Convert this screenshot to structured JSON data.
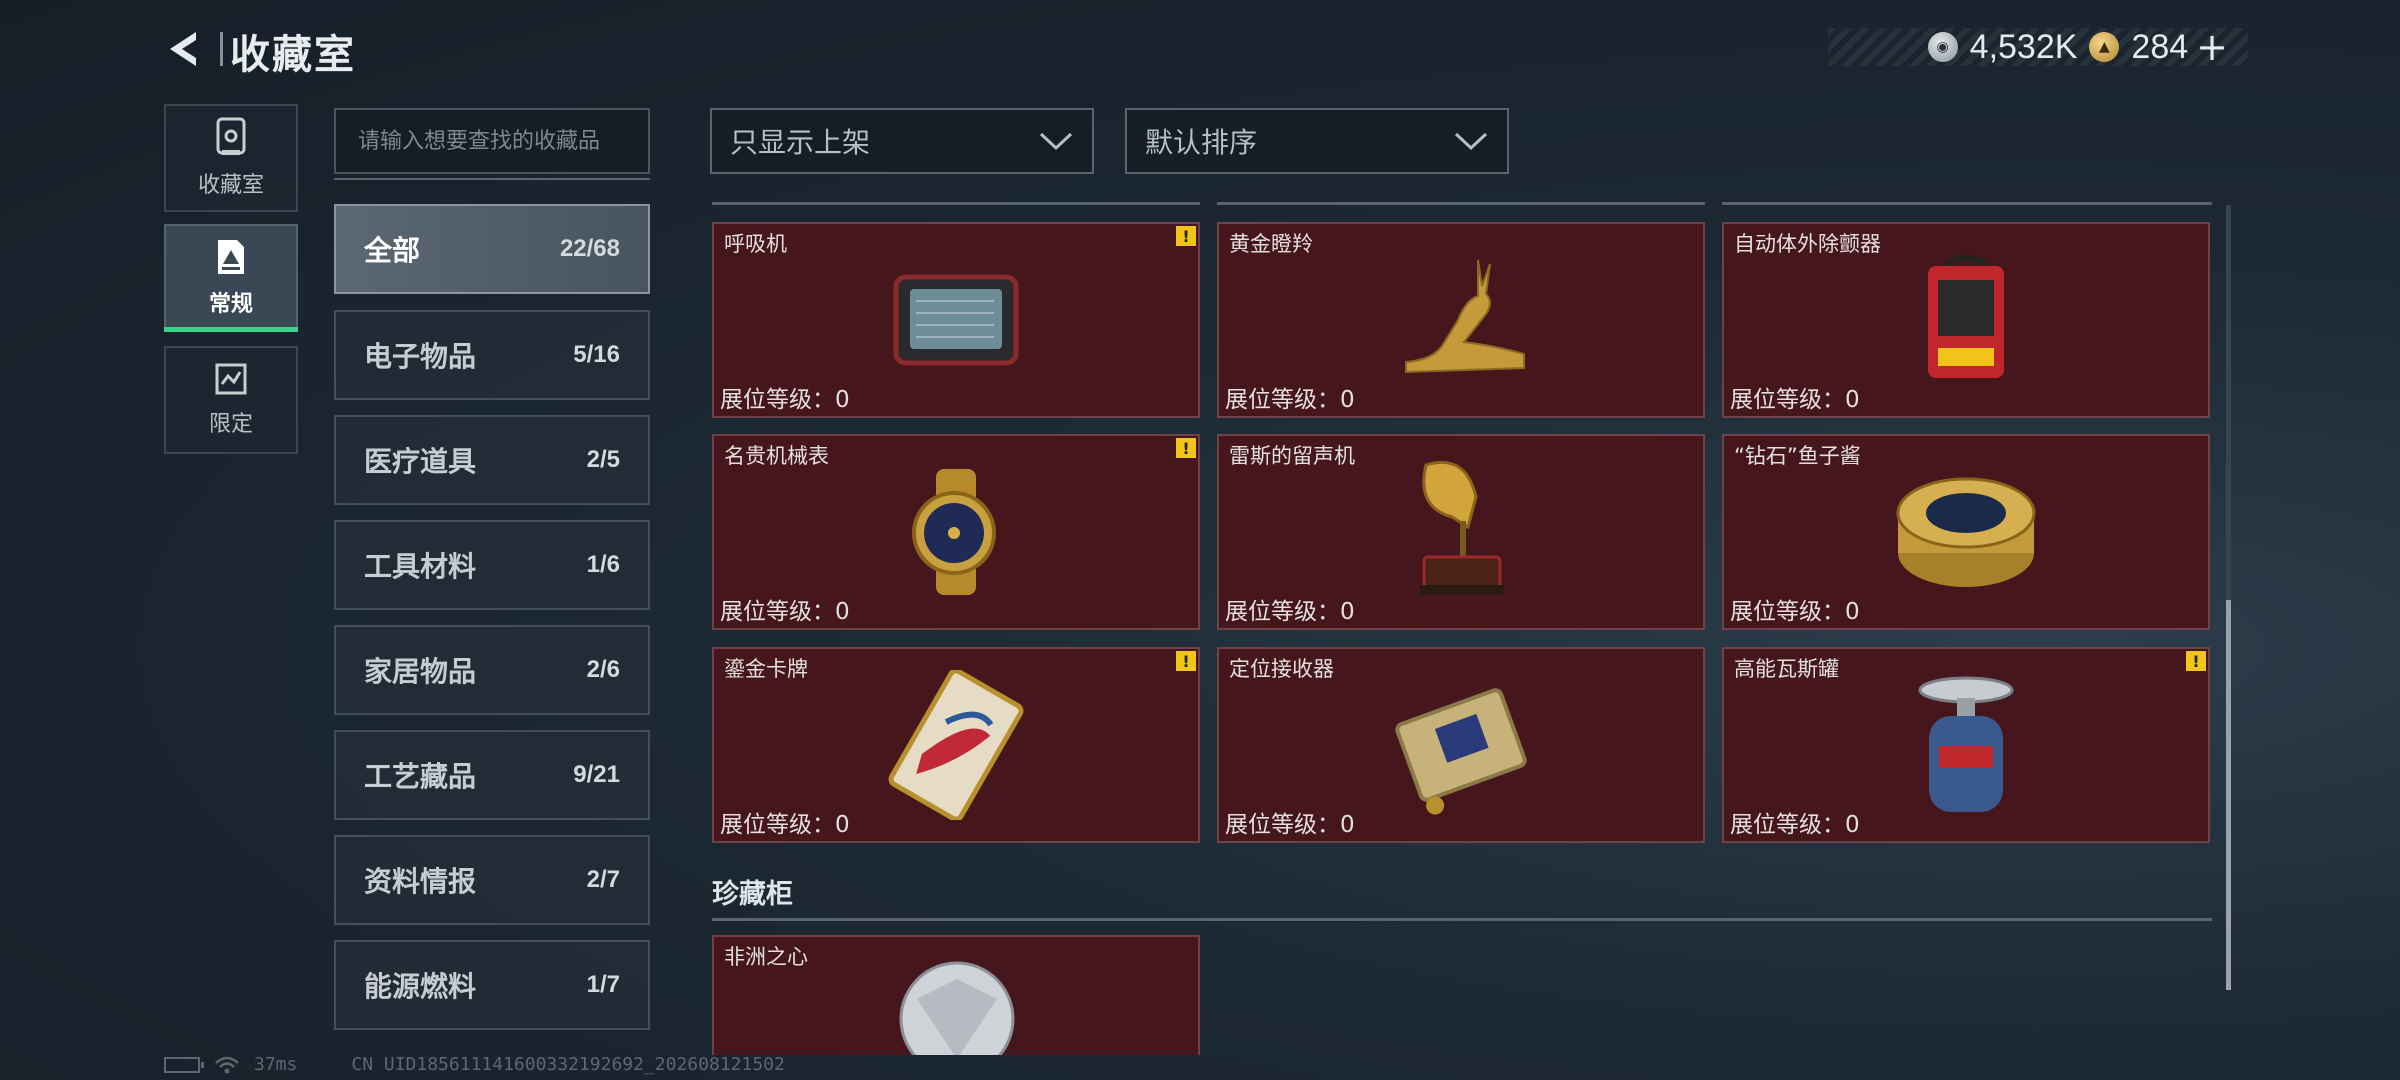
{
  "header": {
    "title": "收藏室"
  },
  "currency": {
    "silver": "4,532K",
    "gold": "284",
    "plus": "+"
  },
  "nav": [
    {
      "label": "收藏室",
      "icon": "cabinet-icon"
    },
    {
      "label": "常规",
      "icon": "document-icon",
      "active": true
    },
    {
      "label": "限定",
      "icon": "limited-icon"
    }
  ],
  "search": {
    "placeholder": "请输入想要查找的收藏品"
  },
  "categories": [
    {
      "name": "全部",
      "count": "22/68",
      "active": true
    },
    {
      "name": "电子物品",
      "count": "5/16"
    },
    {
      "name": "医疗道具",
      "count": "2/5"
    },
    {
      "name": "工具材料",
      "count": "1/6"
    },
    {
      "name": "家居物品",
      "count": "2/6"
    },
    {
      "name": "工艺藏品",
      "count": "9/21"
    },
    {
      "name": "资料情报",
      "count": "2/7"
    },
    {
      "name": "能源燃料",
      "count": "1/7"
    }
  ],
  "filters": {
    "listing": "只显示上架",
    "sort": "默认排序"
  },
  "items": [
    {
      "name": "呼吸机",
      "level_label": "展位等级：",
      "level": "0",
      "warning": "!",
      "icon": "ventilator-icon"
    },
    {
      "name": "黄金瞪羚",
      "level_label": "展位等级：",
      "level": "0",
      "icon": "golden-gazelle-icon"
    },
    {
      "name": "自动体外除颤器",
      "level_label": "展位等级：",
      "level": "0",
      "icon": "defibrillator-icon"
    },
    {
      "name": "名贵机械表",
      "level_label": "展位等级：",
      "level": "0",
      "warning": "!",
      "icon": "watch-icon"
    },
    {
      "name": "雷斯的留声机",
      "level_label": "展位等级：",
      "level": "0",
      "icon": "gramophone-icon"
    },
    {
      "name": "“钻石”鱼子酱",
      "level_label": "展位等级：",
      "level": "0",
      "icon": "caviar-tin-icon"
    },
    {
      "name": "鎏金卡牌",
      "level_label": "展位等级：",
      "level": "0",
      "warning": "!",
      "icon": "gilded-card-icon"
    },
    {
      "name": "定位接收器",
      "level_label": "展位等级：",
      "level": "0",
      "icon": "locator-receiver-icon"
    },
    {
      "name": "高能瓦斯罐",
      "level_label": "展位等级：",
      "level": "0",
      "warning": "!",
      "icon": "gas-canister-icon"
    }
  ],
  "section": {
    "title": "珍藏柜"
  },
  "vault_items": [
    {
      "name": "非洲之心",
      "icon": "diamond-icon"
    }
  ],
  "footer": {
    "ping": "37ms",
    "uid": "CN UID1856111416003321926​92_202608121502"
  }
}
